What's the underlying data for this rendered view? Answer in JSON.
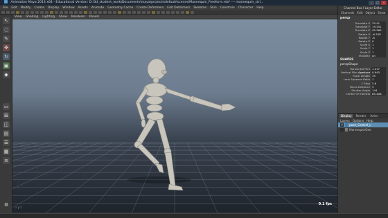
{
  "window": {
    "title": "Animation Maya 2013 x64 - Educational Version: D:\\3d_student_work\\Documents\\maya\\projects\\default\\scenes\\Mannequin_Freeform.mb* --- mannequin_ctrl...",
    "controls": {
      "minimize": "_",
      "maximize": "□",
      "close": "×"
    }
  },
  "menubar": {
    "items": [
      "File",
      "Edit",
      "Modify",
      "Create",
      "Display",
      "Window",
      "Assets",
      "Animate",
      "Geometry Cache",
      "Create Deformers",
      "Edit Deformers",
      "Skeleton",
      "Skin",
      "Constrain",
      "Character",
      "Help"
    ]
  },
  "viewport_menu": {
    "items": [
      "View",
      "Shading",
      "Lighting",
      "Show",
      "Renderer",
      "Panels"
    ]
  },
  "viewport": {
    "fps": "0.1 fps",
    "axis": {
      "x": "x",
      "y": "y",
      "z": "z"
    }
  },
  "channel_box": {
    "header": "Channel Box / Layer Editor",
    "tabs": [
      "Channels",
      "Edit",
      "Object",
      "Show"
    ],
    "node": "persp",
    "attributes": [
      {
        "name": "Translate X",
        "value": "35.41"
      },
      {
        "name": "Translate Y",
        "value": "19.351"
      },
      {
        "name": "Translate Z",
        "value": "95.369"
      },
      {
        "name": "Rotate X",
        "value": "-6.338"
      },
      {
        "name": "Rotate Y",
        "value": "-8"
      },
      {
        "name": "Rotate Z",
        "value": "0"
      },
      {
        "name": "Scale X",
        "value": "1"
      },
      {
        "name": "Scale Y",
        "value": "1"
      },
      {
        "name": "Scale Z",
        "value": "1"
      },
      {
        "name": "Visibility",
        "value": "on"
      }
    ],
    "shapes_label": "SHAPES",
    "shape_node": "perspShape",
    "shape_attributes": [
      {
        "name": "Horizontal Film Aperture",
        "value": "1.417"
      },
      {
        "name": "Vertical Film Aperture",
        "value": "0.945"
      },
      {
        "name": "Focal Length",
        "value": "35"
      },
      {
        "name": "Lens Squeeze Ratio",
        "value": "1"
      },
      {
        "name": "F Stop",
        "value": "5.6"
      },
      {
        "name": "Focus Distance",
        "value": "5"
      },
      {
        "name": "Shutter Angle",
        "value": "144"
      },
      {
        "name": "Center Of Interest",
        "value": "85.406"
      }
    ]
  },
  "layer_editor": {
    "tabs": [
      "Display",
      "Render",
      "Anim"
    ],
    "menu": [
      "Layers",
      "Options",
      "Help"
    ],
    "layers": [
      {
        "vis": "V",
        "name": "pose_Control_L",
        "color": "#4a7aa8"
      },
      {
        "vis": "",
        "name": "MannequinGeo",
        "color": "#7a7a7a"
      }
    ]
  },
  "colors": {
    "title_bar": "#1e2a38",
    "panel_bg": "#404040",
    "viewport_sky": "#7d8ea0",
    "selection": "#5d8fb4",
    "mannequin": "#c8c5bd"
  }
}
